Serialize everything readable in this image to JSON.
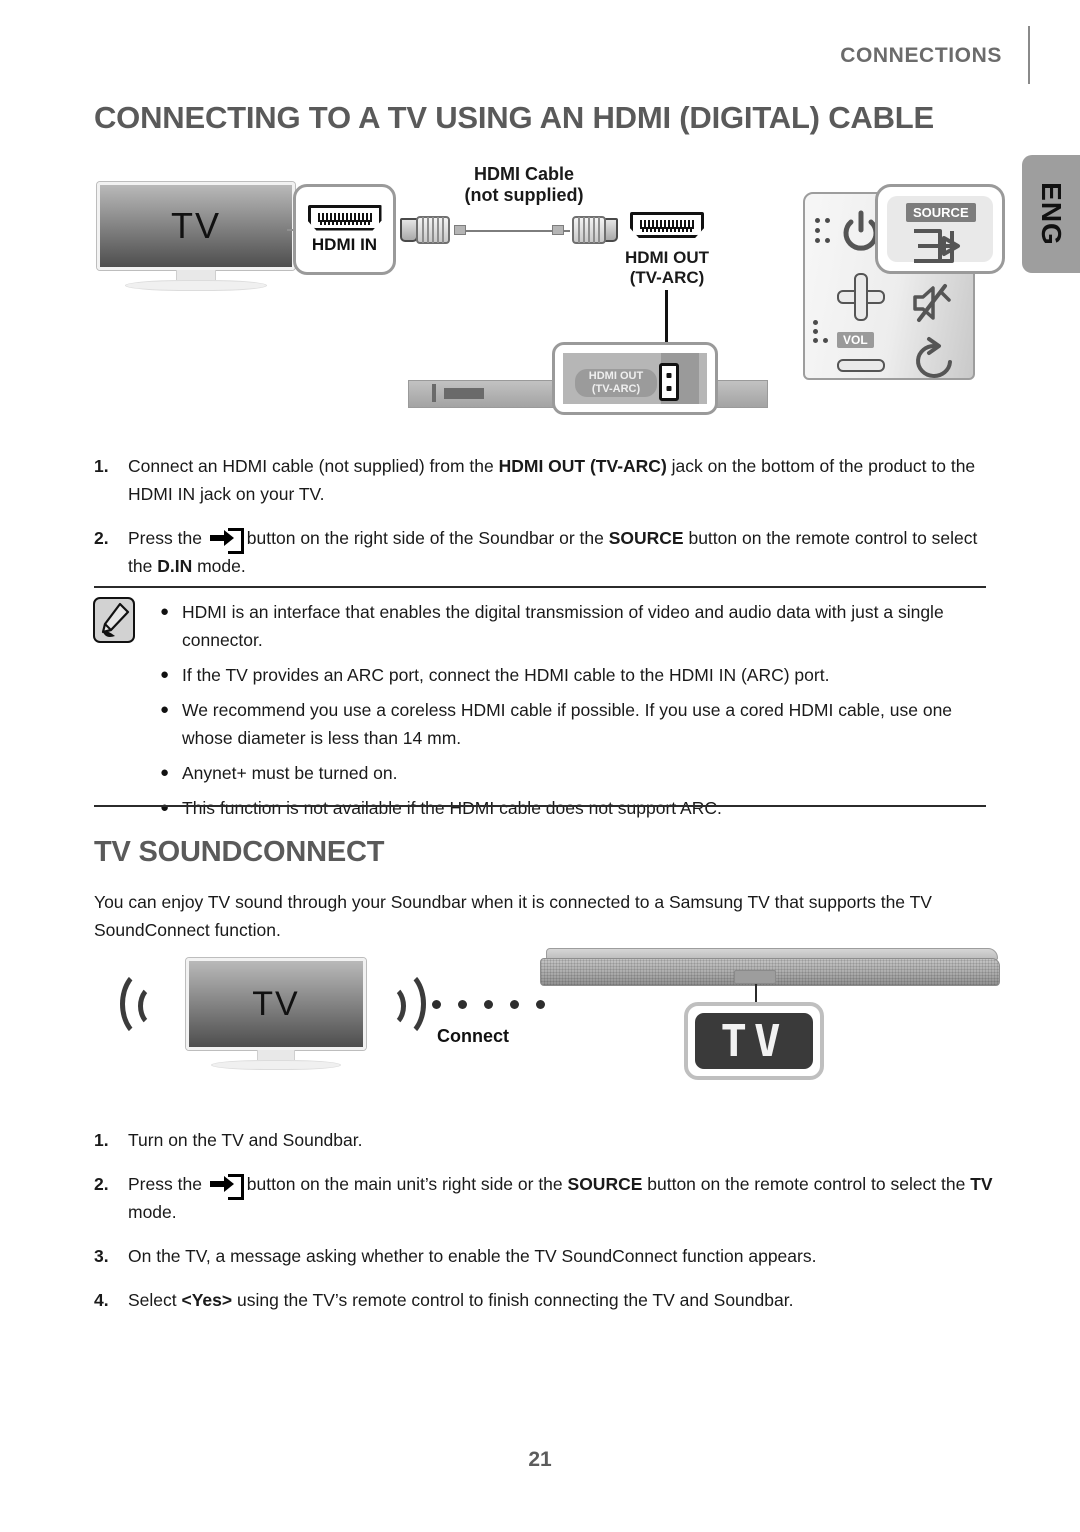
{
  "header": {
    "chapter_label": "CONNECTIONS",
    "language_tab": "ENG"
  },
  "section1": {
    "title": "CONNECTING TO A TV USING AN HDMI (DIGITAL) CABLE",
    "diagram": {
      "tv_label": "TV",
      "hdmi_in_label": "HDMI IN",
      "cable_title": "HDMI Cable",
      "cable_subtitle": "(not supplied)",
      "hdmi_out_label_line1": "HDMI OUT",
      "hdmi_out_label_line2": "(TV-ARC)",
      "soundbar_port_label_line1": "HDMI OUT",
      "soundbar_port_label_line2": "(TV-ARC)",
      "remote_source_label": "SOURCE",
      "remote_vol_label": "VOL"
    },
    "steps": [
      {
        "num": "1.",
        "parts": [
          {
            "t": "Connect an HDMI cable (not supplied) from the ",
            "b": false
          },
          {
            "t": "HDMI OUT (TV-ARC)",
            "b": true
          },
          {
            "t": " jack on the bottom of the product to the HDMI IN jack on your TV.",
            "b": false
          }
        ]
      },
      {
        "num": "2.",
        "parts": [
          {
            "t": "Press the ",
            "b": false
          },
          {
            "t": "__SRC__",
            "b": false
          },
          {
            "t": "button on the right side of the Soundbar or the ",
            "b": false
          },
          {
            "t": "SOURCE",
            "b": true
          },
          {
            "t": " button on the remote control to select the ",
            "b": false
          },
          {
            "t": "D.IN",
            "b": true
          },
          {
            "t": " mode.",
            "b": false
          }
        ]
      }
    ],
    "notes": [
      "HDMI is an interface that enables the digital transmission of video and audio data with just a single connector.",
      "If the TV provides an ARC port, connect the HDMI cable to the HDMI IN (ARC) port.",
      "We recommend you use a coreless HDMI cable if possible. If you use a cored HDMI cable, use one whose diameter is less than 14 mm.",
      "Anynet+ must be turned on.",
      "This function is not available if the HDMI cable does not support ARC."
    ],
    "note_bullet": "●"
  },
  "section2": {
    "title": "TV SOUNDCONNECT",
    "intro": "You can enjoy TV sound through your Soundbar when it is connected to a Samsung TV that supports the TV SoundConnect function.",
    "diagram": {
      "tv_label": "TV",
      "connect_label": "Connect",
      "display_text": "TV"
    },
    "steps": [
      {
        "num": "1.",
        "parts": [
          {
            "t": "Turn on the TV and Soundbar.",
            "b": false
          }
        ]
      },
      {
        "num": "2.",
        "parts": [
          {
            "t": "Press the ",
            "b": false
          },
          {
            "t": "__SRC__",
            "b": false
          },
          {
            "t": "button on the main unit’s right side or the ",
            "b": false
          },
          {
            "t": "SOURCE",
            "b": true
          },
          {
            "t": " button on the remote control to select the ",
            "b": false
          },
          {
            "t": "TV",
            "b": true
          },
          {
            "t": " mode.",
            "b": false
          }
        ]
      },
      {
        "num": "3.",
        "parts": [
          {
            "t": "On the TV, a message asking whether to enable the TV SoundConnect function appears.",
            "b": false
          }
        ]
      },
      {
        "num": "4.",
        "parts": [
          {
            "t": "Select ",
            "b": false
          },
          {
            "t": "<Yes>",
            "b": true
          },
          {
            "t": " using the TV’s remote control to finish connecting the TV and Soundbar.",
            "b": false
          }
        ]
      }
    ]
  },
  "footer": {
    "page_number": "21"
  },
  "colors": {
    "heading": "#5a5a5a",
    "body_text": "#1a1a1a",
    "tab_bg": "#9e9e9e",
    "rule": "#2b2b2b"
  }
}
